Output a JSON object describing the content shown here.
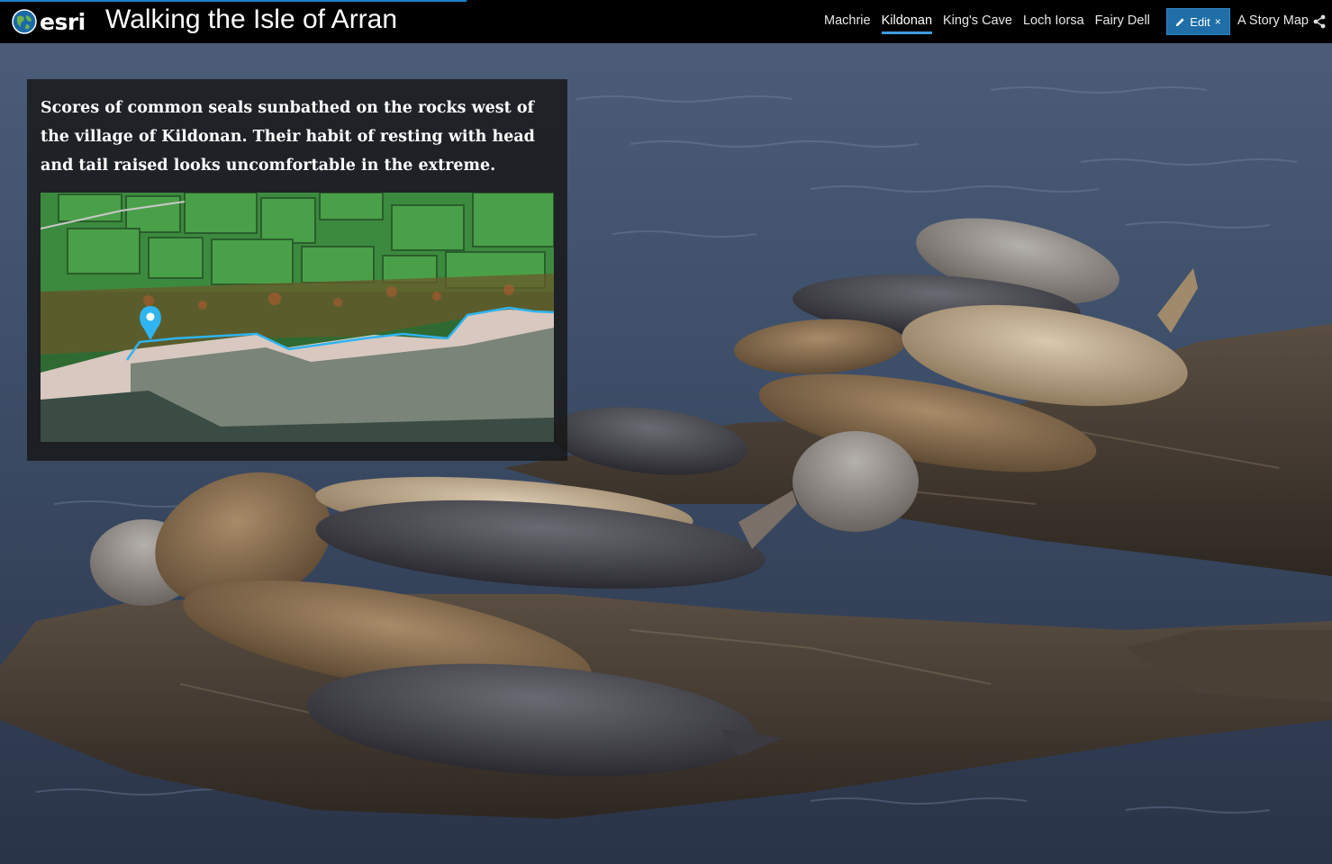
{
  "header": {
    "brand": "esri",
    "title": "Walking the Isle of Arran",
    "nav": [
      {
        "label": "Machrie",
        "active": false
      },
      {
        "label": "Kildonan",
        "active": true
      },
      {
        "label": "King's Cave",
        "active": false
      },
      {
        "label": "Loch Iorsa",
        "active": false
      },
      {
        "label": "Fairy Dell",
        "active": false
      }
    ],
    "edit_label": "Edit",
    "edit_close": "×",
    "story_map_label": "A Story Map",
    "progress_percent": 35
  },
  "panel": {
    "caption": "Scores of common seals sunbathed on the rocks west of the village of Kildonan. Their habit of resting with head and tail raised looks uncomfortable in the extreme."
  },
  "colors": {
    "accent": "#3b9be0",
    "edit_button": "#1f6ea8",
    "route_line": "#2fb4f0",
    "header_bg": "#000000"
  },
  "icons": {
    "logo": "globe-icon",
    "edit": "pencil-icon",
    "share": "share-icon",
    "map_marker": "location-pin-icon"
  }
}
